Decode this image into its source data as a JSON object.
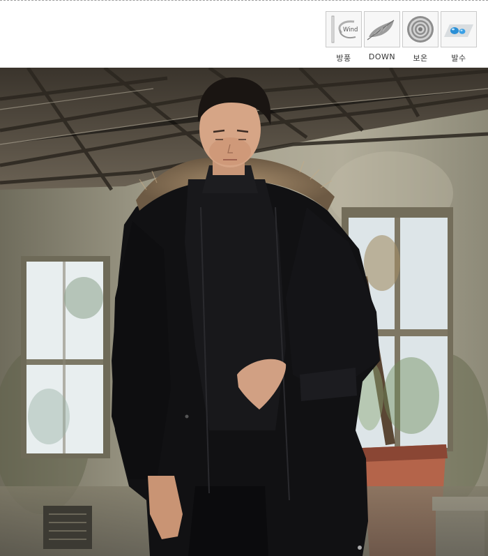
{
  "features": [
    {
      "icon": "wind-icon",
      "label": "방풍",
      "icon_text": "Wind"
    },
    {
      "icon": "feather-icon",
      "label": "DOWN"
    },
    {
      "icon": "insulation-rings-icon",
      "label": "보온"
    },
    {
      "icon": "water-drops-icon",
      "label": "발수"
    }
  ],
  "photo": {
    "subject": "model-wearing-black-fur-hood-down-parka"
  },
  "colors": {
    "jacket": "#101012",
    "fur": "#8a7358",
    "wall": "#8f8b78",
    "window": "#dfe6e8",
    "crate": "#b4644a"
  }
}
